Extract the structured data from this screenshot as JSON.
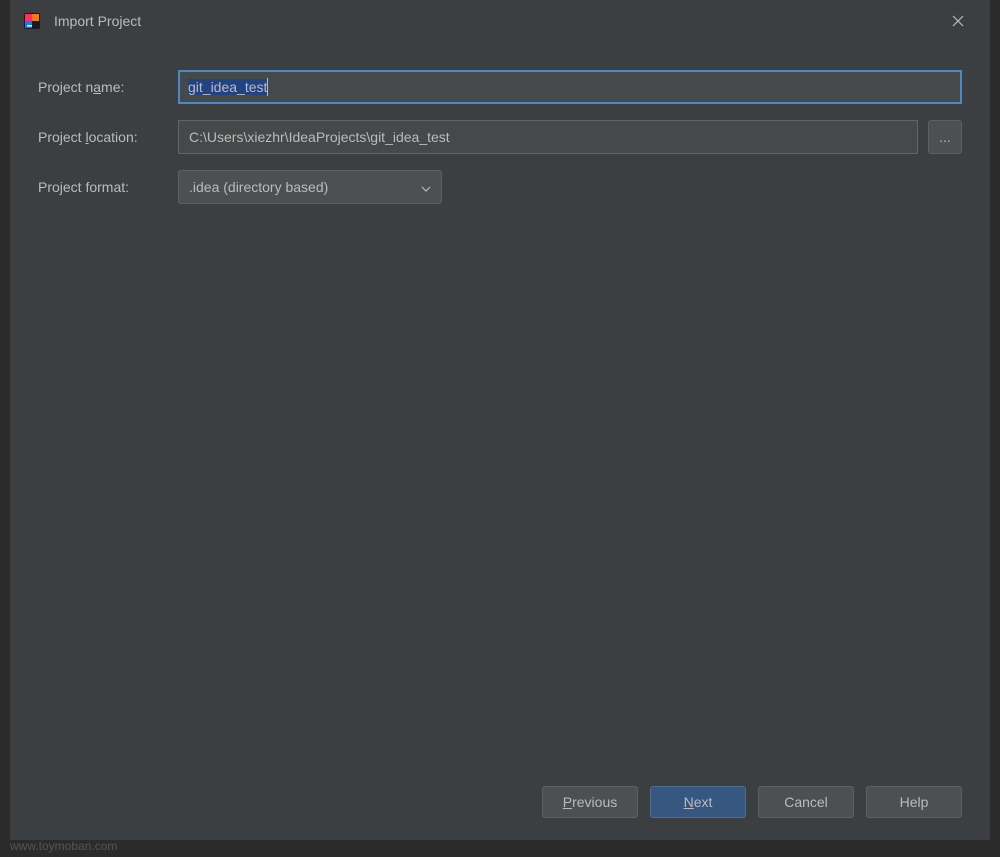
{
  "dialog": {
    "title": "Import Project",
    "close_tooltip": "Close"
  },
  "form": {
    "project_name": {
      "label_prefix": "Project n",
      "label_underline": "a",
      "label_suffix": "me:",
      "value": "git_idea_test"
    },
    "project_location": {
      "label_prefix": "Project ",
      "label_underline": "l",
      "label_suffix": "ocation:",
      "value": "C:\\Users\\xiezhr\\IdeaProjects\\git_idea_test",
      "browse_label": "..."
    },
    "project_format": {
      "label": "Project format:",
      "selected": ".idea (directory based)"
    }
  },
  "buttons": {
    "previous_underline": "P",
    "previous_rest": "revious",
    "next_underline": "N",
    "next_rest": "ext",
    "cancel": "Cancel",
    "help": "Help"
  },
  "watermark": "www.toymoban.com"
}
